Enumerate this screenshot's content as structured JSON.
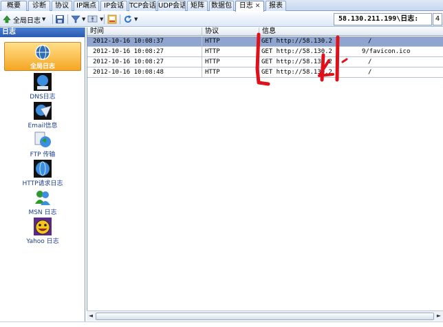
{
  "tabs": [
    {
      "label": "概要"
    },
    {
      "label": "诊断"
    },
    {
      "label": "协议"
    },
    {
      "label": "IP端点"
    },
    {
      "label": "IP会话"
    },
    {
      "label": "TCP会话"
    },
    {
      "label": "UDP会话"
    },
    {
      "label": "矩阵"
    },
    {
      "label": "数据包"
    },
    {
      "label": "日志",
      "active": true,
      "close": "✕"
    },
    {
      "label": "报表"
    }
  ],
  "toolbar": {
    "scope_label": "全局日志",
    "ip_display": "58.130.211.199\\日志:",
    "count_display": "4",
    "colors": {
      "green_arrow": "#2e9a2e",
      "save": "#3a5fa8",
      "filter": "#4a78c2",
      "refresh": "#2f74d0"
    }
  },
  "left_panel": {
    "header": "日志",
    "items": [
      {
        "label": "全局日志",
        "icon": "global-log-icon",
        "selected": true
      },
      {
        "label": "DNS日志",
        "icon": "dns-log-icon"
      },
      {
        "label": "Email信息",
        "icon": "email-info-icon"
      },
      {
        "label": "FTP 传输",
        "icon": "ftp-transfer-icon"
      },
      {
        "label": "HTTP请求日志",
        "icon": "http-request-log-icon"
      },
      {
        "label": "MSN 日志",
        "icon": "msn-log-icon"
      },
      {
        "label": "Yahoo 日志",
        "icon": "yahoo-log-icon"
      }
    ]
  },
  "table": {
    "columns": [
      "时间",
      "协议",
      "信息"
    ],
    "rows": [
      {
        "time": "2012-10-16 10:08:37",
        "protocol": "HTTP",
        "info": "GET http://58.130.2",
        "info_tail": "/",
        "selected": true
      },
      {
        "time": "2012-10-16 10:08:27",
        "protocol": "HTTP",
        "info": "GET http://58.130.2",
        "info_tail": "9/favicon.ico"
      },
      {
        "time": "2012-10-16 10:08:27",
        "protocol": "HTTP",
        "info": "GET http://58.130.2",
        "info_tail": "/"
      },
      {
        "time": "2012-10-16 10:08:48",
        "protocol": "HTTP",
        "info": "GET http://58.130.2",
        "info_tail": "/"
      }
    ]
  },
  "annotation_color": "#e0101a"
}
